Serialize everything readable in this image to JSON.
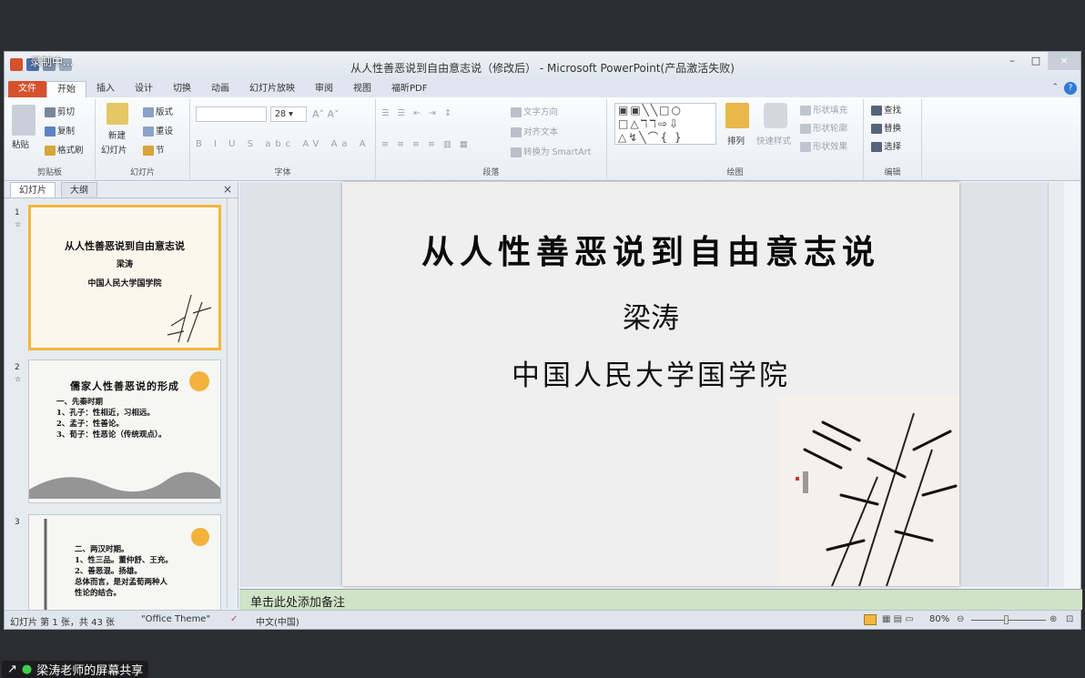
{
  "recording_label": "录制中...",
  "window": {
    "title": "从人性善恶说到自由意志说（修改后） - Microsoft PowerPoint(产品激活失败)",
    "controls": [
      "–",
      "□",
      "×"
    ]
  },
  "ribbon_tabs": [
    "文件",
    "开始",
    "插入",
    "设计",
    "切换",
    "动画",
    "幻灯片放映",
    "审阅",
    "视图",
    "福昕PDF"
  ],
  "ribbon": {
    "clipboard": {
      "paste": "粘贴",
      "cut": "剪切",
      "copy": "复制",
      "format_painter": "格式刷",
      "label": "剪贴板"
    },
    "slides": {
      "new_slide": "新建",
      "new_slide2": "幻灯片",
      "layout": "版式",
      "reset": "重设",
      "section": "节",
      "label": "幻灯片"
    },
    "font": {
      "size": "28",
      "label": "字体"
    },
    "paragraph": {
      "text_direction": "文字方向",
      "align_text": "对齐文本",
      "smartart": "转换为 SmartArt",
      "label": "段落"
    },
    "drawing": {
      "arrange": "排列",
      "quick_styles": "快速样式",
      "shape_fill": "形状填充",
      "shape_outline": "形状轮廓",
      "shape_effects": "形状效果",
      "label": "绘图"
    },
    "editing": {
      "find": "查找",
      "replace": "替换",
      "select": "选择",
      "label": "编辑"
    }
  },
  "panel": {
    "tabs": [
      "幻灯片",
      "大纲"
    ],
    "close": "×",
    "thumbnails": [
      {
        "num": "1",
        "title": "从人性善恶说到自由意志说",
        "name": "梁涛",
        "inst": "中国人民大学国学院"
      },
      {
        "num": "2",
        "title": "儒家人性善恶说的形成",
        "lines": [
          "一、先秦时期",
          "1、孔子：性相近，习相远。",
          "2、孟子：性善论。",
          "3、荀子：性恶论（传统观点）。"
        ]
      },
      {
        "num": "3",
        "lines": [
          "二、两汉时期。",
          "1、性三品。董仲舒、王充。",
          "2、善恶混。扬雄。",
          "总体而言，是对孟荀两种人",
          "性论的结合。"
        ]
      }
    ]
  },
  "slide": {
    "title": "从人性善恶说到自由意志说",
    "author": "梁涛",
    "institution": "中国人民大学国学院"
  },
  "notes_placeholder": "单击此处添加备注",
  "status": {
    "slide_info": "幻灯片 第 1 张，共 43 张",
    "theme": "\"Office Theme\"",
    "language": "中文(中国)",
    "zoom": "80%"
  },
  "share_label": "梁涛老师的屏幕共享",
  "colors": {
    "file_tab": "#d5512c",
    "selected_thumb": "#f3b63f",
    "notes_bg": "#cfe3c6"
  }
}
